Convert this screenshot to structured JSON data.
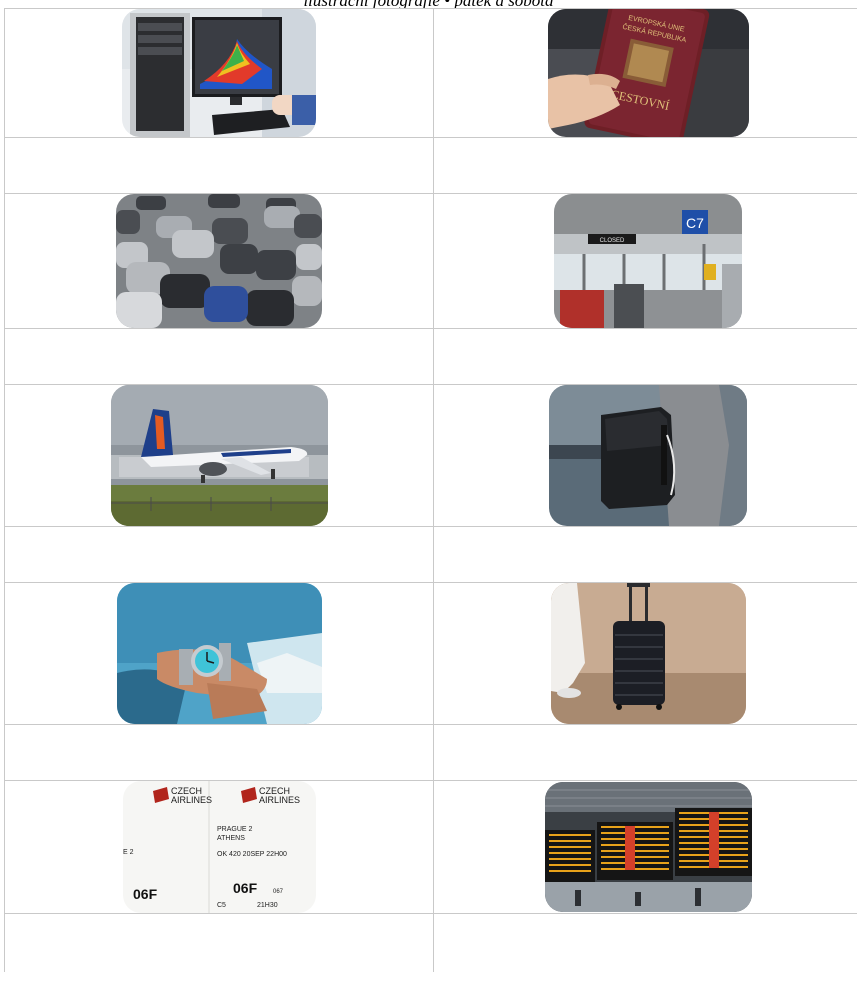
{
  "caption": "ilustrační fotografie • pátek a sobota",
  "photos": [
    {
      "name": "computer-workstation-photo",
      "icon": "computer-screen-with-3d-graph"
    },
    {
      "name": "passport-photo",
      "icon": "czech-passport-in-hand",
      "text": {
        "top": "EVROPSKÁ UNIE",
        "mid": "ČESKÁ REPUBLIKA",
        "bottom": "CESTOVNÍ"
      }
    },
    {
      "name": "parking-lot-photo",
      "icon": "parked-cars"
    },
    {
      "name": "airport-gate-photo",
      "icon": "airport-gate-c7",
      "text": {
        "gate": "C7",
        "screen": "CLOSED"
      }
    },
    {
      "name": "airplane-photo",
      "icon": "smartwings-airplane"
    },
    {
      "name": "backpack-photo",
      "icon": "black-backpack"
    },
    {
      "name": "wristwatch-photo",
      "icon": "wristwatch"
    },
    {
      "name": "suitcase-photo",
      "icon": "black-suitcase"
    },
    {
      "name": "boarding-pass-photo",
      "icon": "czech-airlines-boarding-pass",
      "text": {
        "brand1": "CZECH",
        "brand2": "AIRLINES",
        "line1": "PRAGUE 2",
        "line2": "ATHENS",
        "flight": "OK 420 20SEP 22H00",
        "seat": "06F",
        "seatsmall": "067",
        "gate": "C5",
        "time": "21H30",
        "left1": "E 2",
        "left2": "06F"
      }
    },
    {
      "name": "departure-board-photo",
      "icon": "airport-departures-board"
    }
  ]
}
